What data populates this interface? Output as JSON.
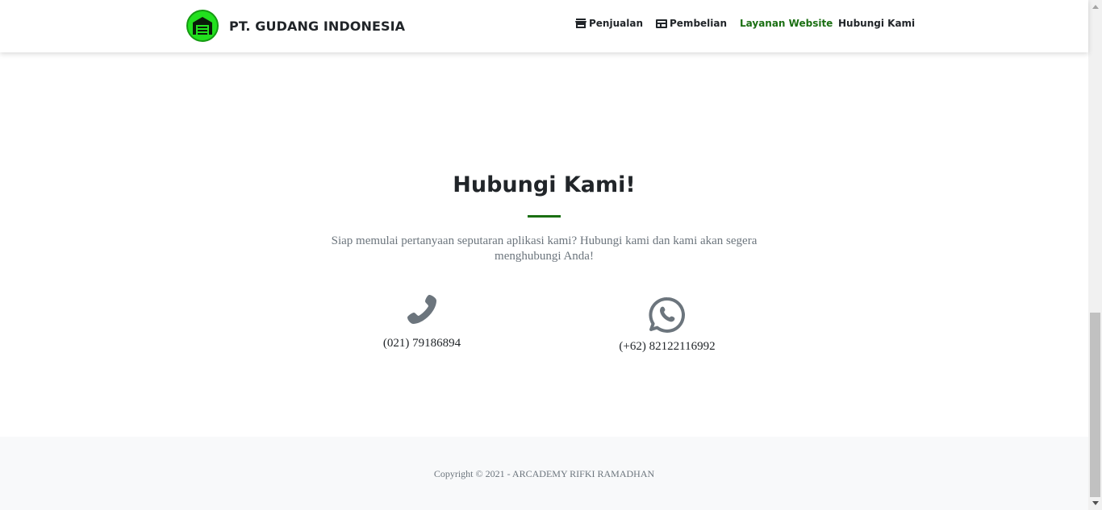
{
  "brand": {
    "name": "PT. GUDANG INDONESIA",
    "logo_icon": "warehouse-icon",
    "logo_color": "#22e01e"
  },
  "nav": {
    "items": [
      {
        "label": "Penjualan",
        "icon": "store-icon"
      },
      {
        "label": "Pembelian",
        "icon": "cash-register-icon"
      },
      {
        "label": "Layanan Website",
        "icon": "",
        "active": true
      },
      {
        "label": "Hubungi Kami",
        "icon": ""
      }
    ],
    "active_color": "#1a6f12"
  },
  "contact": {
    "heading": "Hubungi Kami!",
    "lead": "Siap memulai pertanyaan seputaran aplikasi kami? Hubungi kami dan kami akan segera menghubungi Anda!",
    "phone": {
      "icon": "phone-icon",
      "value": "(021) 79186894"
    },
    "whatsapp": {
      "icon": "whatsapp-icon",
      "value": "(+62) 82122116992"
    }
  },
  "footer": {
    "copyright": "Copyright © 2021 - ARCADEMY RIFKI RAMADHAN"
  }
}
